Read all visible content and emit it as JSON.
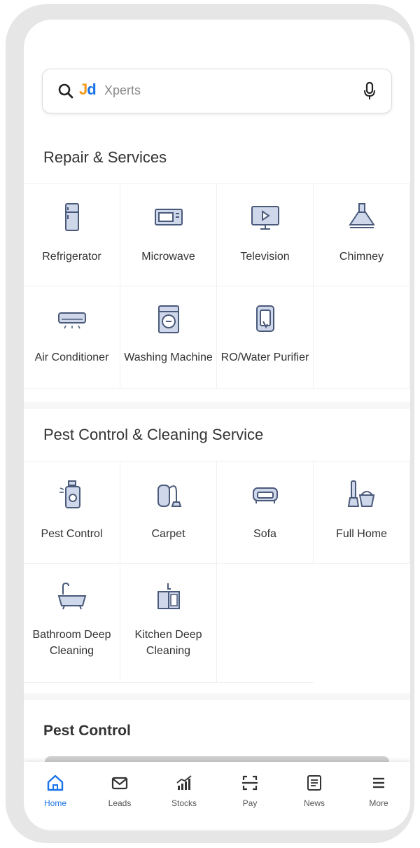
{
  "search": {
    "brand_j": "J",
    "brand_d": "d",
    "placeholder": "Xperts"
  },
  "repair_section": {
    "title": "Repair & Services",
    "items": [
      {
        "label": "Refrigerator",
        "icon": "refrigerator-icon"
      },
      {
        "label": "Microwave",
        "icon": "microwave-icon"
      },
      {
        "label": "Television",
        "icon": "television-icon"
      },
      {
        "label": "Chimney",
        "icon": "chimney-icon"
      },
      {
        "label": "Air Conditioner",
        "icon": "air-conditioner-icon"
      },
      {
        "label": "Washing Machine",
        "icon": "washing-machine-icon"
      },
      {
        "label": "RO/Water Purifier",
        "icon": "water-purifier-icon"
      }
    ]
  },
  "cleaning_section": {
    "title": "Pest Control & Cleaning Service",
    "items": [
      {
        "label": "Pest Control",
        "icon": "pest-spray-icon"
      },
      {
        "label": "Carpet",
        "icon": "vacuum-icon"
      },
      {
        "label": "Sofa",
        "icon": "sofa-icon"
      },
      {
        "label": "Full Home",
        "icon": "cleaning-bucket-icon"
      },
      {
        "label": "Bathroom Deep Cleaning",
        "icon": "bathtub-icon"
      },
      {
        "label": "Kitchen Deep Cleaning",
        "icon": "kitchen-sink-icon"
      }
    ]
  },
  "pest_control": {
    "title": "Pest Control"
  },
  "bottom_nav": {
    "items": [
      {
        "label": "Home",
        "icon": "home-icon",
        "active": true
      },
      {
        "label": "Leads",
        "icon": "mail-icon"
      },
      {
        "label": "Stocks",
        "icon": "chart-icon"
      },
      {
        "label": "Pay",
        "icon": "scan-icon"
      },
      {
        "label": "News",
        "icon": "news-icon"
      },
      {
        "label": "More",
        "icon": "menu-icon"
      }
    ]
  },
  "colors": {
    "accent": "#1a73e8",
    "brand_orange": "#f39a1e",
    "icon_fill": "#cfd8ea",
    "icon_stroke": "#4a5a7a"
  }
}
